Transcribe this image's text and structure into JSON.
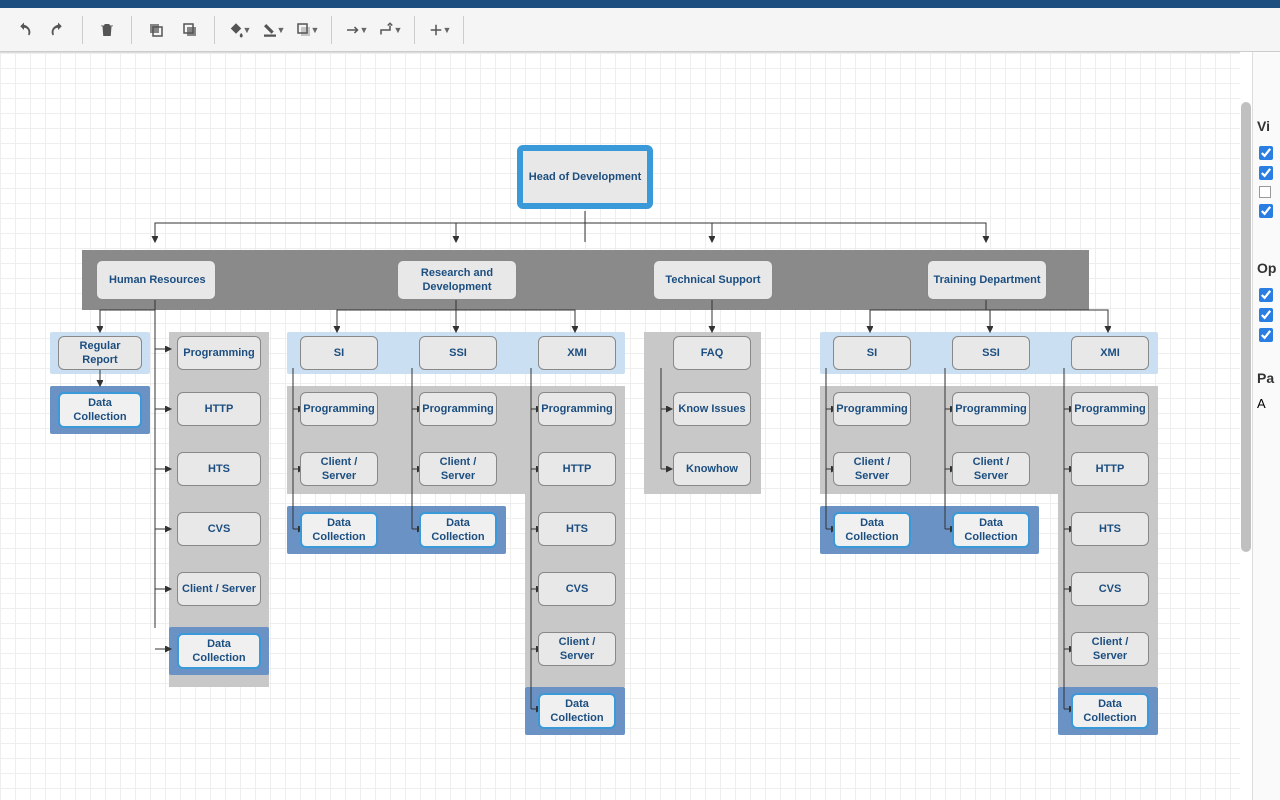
{
  "toolbar_icons": [
    "undo",
    "redo",
    "delete",
    "front",
    "back",
    "fill",
    "line",
    "shadow",
    "arrow-end",
    "connector",
    "add"
  ],
  "nodes": {
    "root": "Head of Development",
    "dept1": "Human Resources",
    "dept2": "Research and Development",
    "dept3": "Technical Support",
    "dept4": "Training Department",
    "hr_report": "Regular Report",
    "hr_prog": "Programming",
    "hr_dc": "Data Collection",
    "hr_http": "HTTP",
    "hr_hts": "HTS",
    "hr_cvs": "CVS",
    "hr_cs": "Client / Server",
    "hr_dc2": "Data Collection",
    "rd_si": "SI",
    "rd_ssi": "SSI",
    "rd_xmi": "XMI",
    "rd_si_prog": "Programming",
    "rd_si_cs": "Client / Server",
    "rd_si_dc": "Data Collection",
    "rd_ssi_prog": "Programming",
    "rd_ssi_cs": "Client / Server",
    "rd_ssi_dc": "Data Collection",
    "rd_xmi_prog": "Programming",
    "rd_xmi_http": "HTTP",
    "rd_xmi_hts": "HTS",
    "rd_xmi_cvs": "CVS",
    "rd_xmi_cs": "Client / Server",
    "rd_xmi_dc": "Data Collection",
    "ts_faq": "FAQ",
    "ts_issues": "Know Issues",
    "ts_knowhow": "Knowhow",
    "td_si": "SI",
    "td_ssi": "SSI",
    "td_xmi": "XMI",
    "td_si_prog": "Programming",
    "td_si_cs": "Client / Server",
    "td_si_dc": "Data Collection",
    "td_ssi_prog": "Programming",
    "td_ssi_cs": "Client / Server",
    "td_ssi_dc": "Data Collection",
    "td_xmi_prog": "Programming",
    "td_xmi_http": "HTTP",
    "td_xmi_hts": "HTS",
    "td_xmi_cvs": "CVS",
    "td_xmi_cs": "Client / Server",
    "td_xmi_dc": "Data Collection"
  },
  "panel": {
    "section1": "Vi",
    "section2": "Op",
    "section3": "Pa",
    "letter": "A"
  }
}
